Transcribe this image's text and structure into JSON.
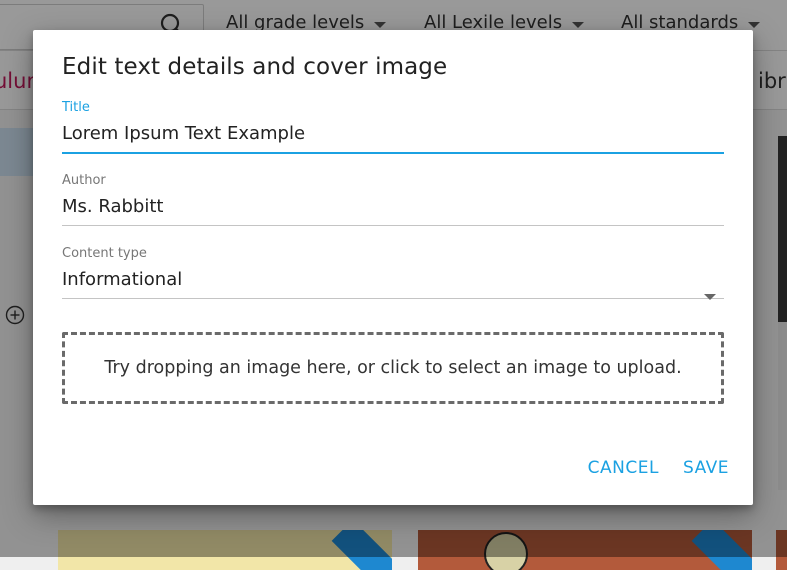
{
  "background": {
    "filters": [
      {
        "label": "All grade levels"
      },
      {
        "label": "All Lexile levels"
      },
      {
        "label": "All standards"
      }
    ],
    "tab_left_fragment": "ulum",
    "tab_right_fragment": "ibra"
  },
  "dialog": {
    "title": "Edit text details and cover image",
    "fields": {
      "title": {
        "label": "Title",
        "value": "Lorem Ipsum Text Example"
      },
      "author": {
        "label": "Author",
        "value": "Ms. Rabbitt"
      },
      "content_type": {
        "label": "Content type",
        "value": "Informational"
      }
    },
    "dropzone_text": "Try dropping an image here, or click to select an image to upload.",
    "cancel_label": "CANCEL",
    "save_label": "SAVE"
  },
  "colors": {
    "accent": "#1ba1e2",
    "scrim": "rgba(0,0,0,0.40)",
    "tab_accent": "#c2185b"
  },
  "icons": {
    "search": "search-icon",
    "dropdown": "chevron-down-icon",
    "add": "add-circle-icon"
  }
}
